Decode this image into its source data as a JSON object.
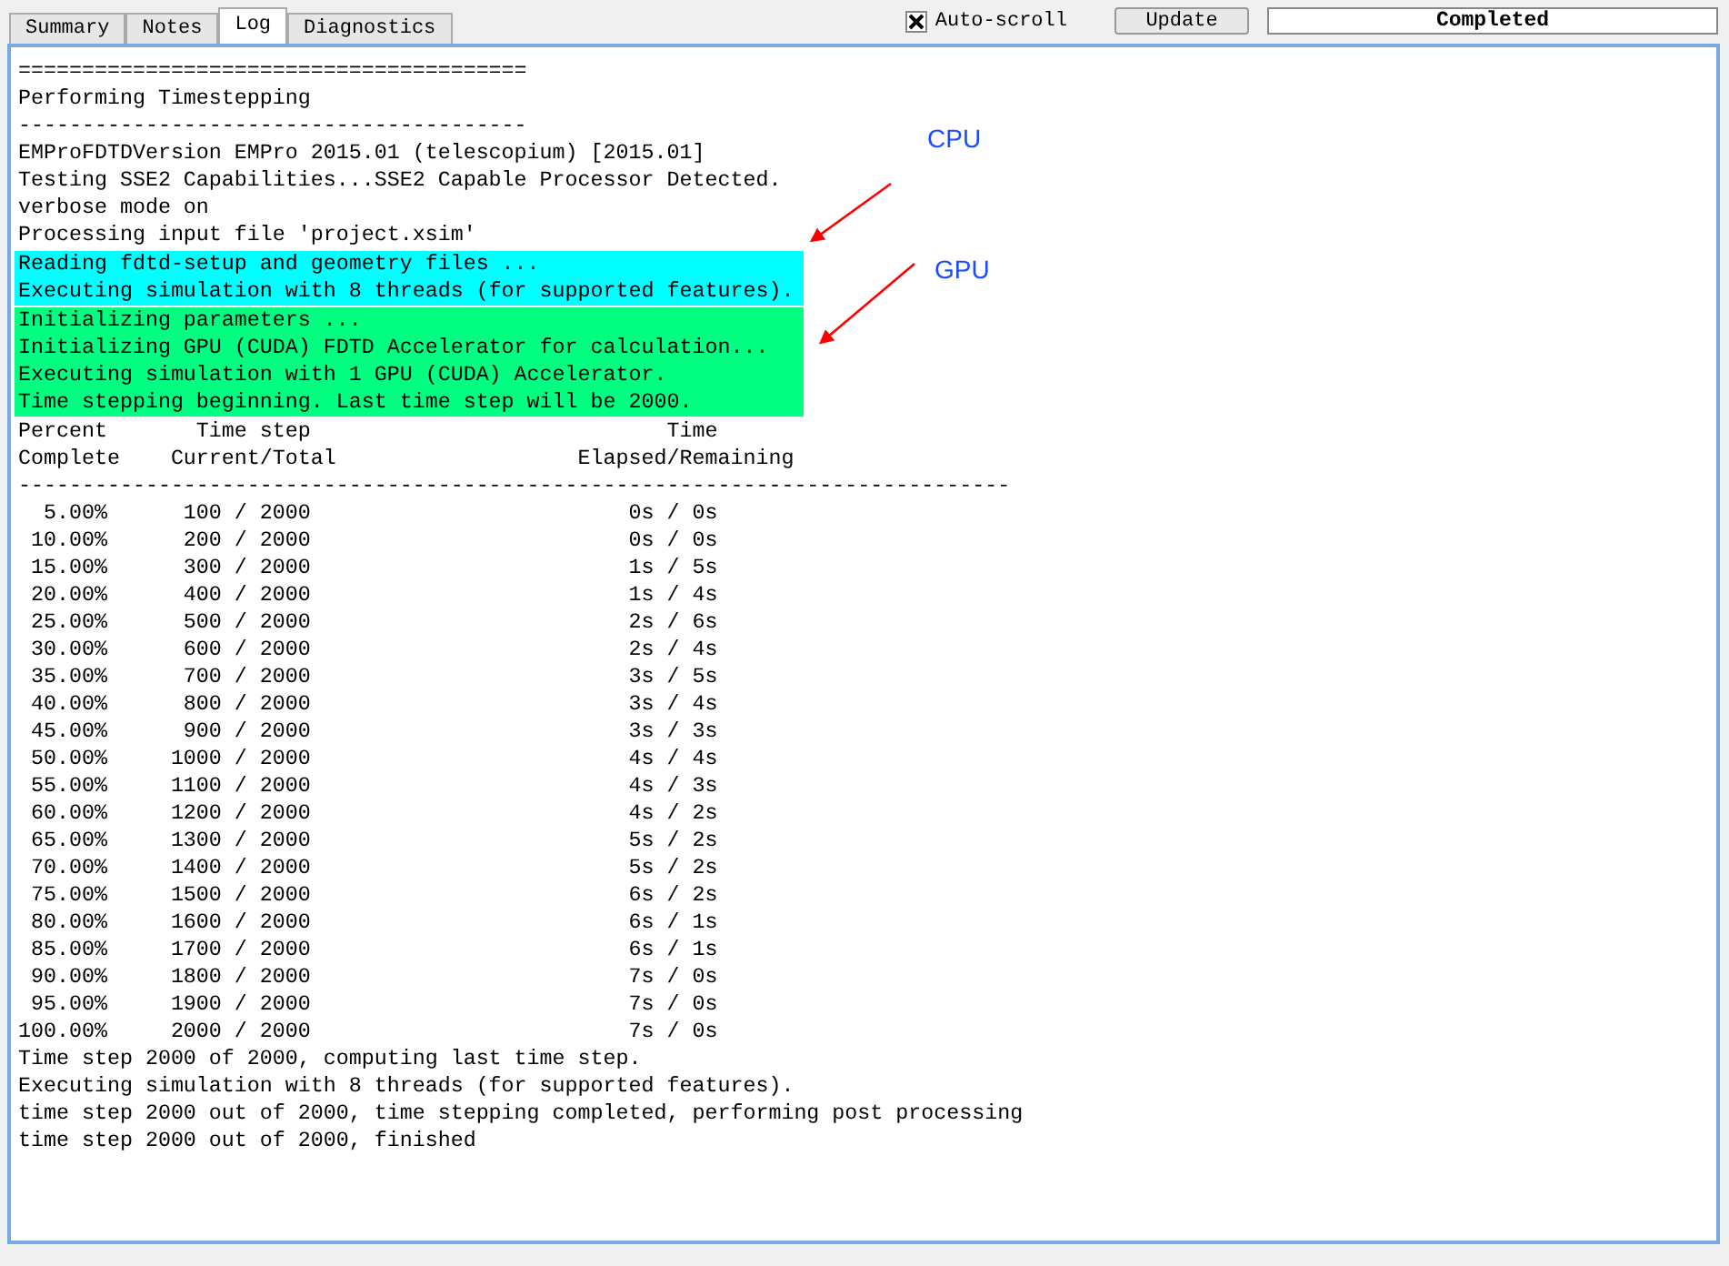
{
  "tabs": [
    {
      "label": "Summary",
      "selected": false
    },
    {
      "label": "Notes",
      "selected": false
    },
    {
      "label": "Log",
      "selected": true
    },
    {
      "label": "Diagnostics",
      "selected": false
    }
  ],
  "auto_scroll": {
    "label": "Auto-scroll",
    "checked": true
  },
  "update_button": "Update",
  "status": "Completed",
  "log": [
    {
      "lines": [
        "========================================",
        "Performing Timestepping",
        "----------------------------------------",
        "EMProFDTDVersion EMPro 2015.01 (telescopium) [2015.01]",
        "Testing SSE2 Capabilities...SSE2 Capable Processor Detected.",
        "verbose mode on",
        "Processing input file 'project.xsim'"
      ]
    },
    {
      "color": "#00ffff",
      "lines": [
        "Reading fdtd-setup and geometry files ...",
        "Executing simulation with 8 threads (for supported features)."
      ]
    },
    {
      "color": "#00ff80",
      "lines": [
        "Initializing parameters ...",
        "Initializing GPU (CUDA) FDTD Accelerator for calculation...",
        "Executing simulation with 1 GPU (CUDA) Accelerator.",
        "Time stepping beginning. Last time step will be 2000."
      ]
    },
    {
      "lines": [
        "Percent       Time step                            Time",
        "Complete    Current/Total                   Elapsed/Remaining",
        "------------------------------------------------------------------------------",
        "  5.00%      100 / 2000                         0s / 0s",
        " 10.00%      200 / 2000                         0s / 0s",
        " 15.00%      300 / 2000                         1s / 5s",
        " 20.00%      400 / 2000                         1s / 4s",
        " 25.00%      500 / 2000                         2s / 6s",
        " 30.00%      600 / 2000                         2s / 4s",
        " 35.00%      700 / 2000                         3s / 5s",
        " 40.00%      800 / 2000                         3s / 4s",
        " 45.00%      900 / 2000                         3s / 3s",
        " 50.00%     1000 / 2000                         4s / 4s",
        " 55.00%     1100 / 2000                         4s / 3s",
        " 60.00%     1200 / 2000                         4s / 2s",
        " 65.00%     1300 / 2000                         5s / 2s",
        " 70.00%     1400 / 2000                         5s / 2s",
        " 75.00%     1500 / 2000                         6s / 2s",
        " 80.00%     1600 / 2000                         6s / 1s",
        " 85.00%     1700 / 2000                         6s / 1s",
        " 90.00%     1800 / 2000                         7s / 0s",
        " 95.00%     1900 / 2000                         7s / 0s",
        "100.00%     2000 / 2000                         7s / 0s",
        "Time step 2000 of 2000, computing last time step.",
        "Executing simulation with 8 threads (for supported features).",
        "time step 2000 out of 2000, time stepping completed, performing post processing",
        "time step 2000 out of 2000, finished"
      ]
    }
  ],
  "annotations": [
    {
      "text": "CPU"
    },
    {
      "text": "GPU"
    }
  ]
}
